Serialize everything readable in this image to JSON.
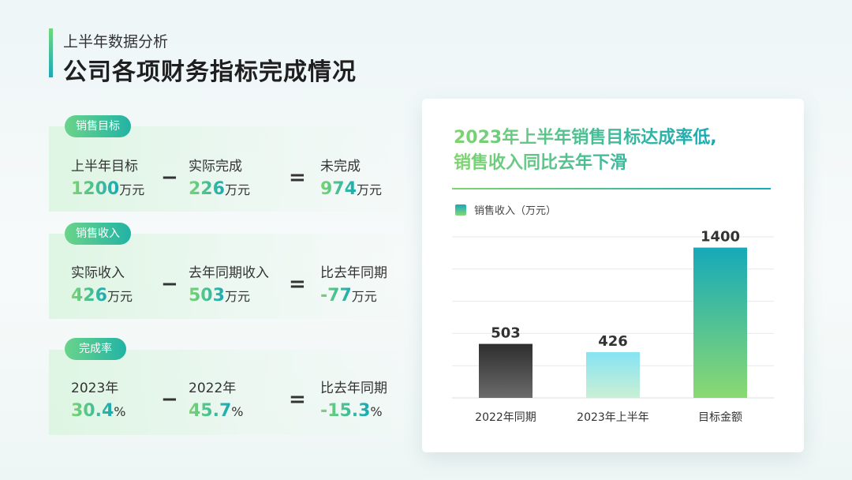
{
  "header": {
    "subtitle": "上半年数据分析",
    "title": "公司各项财务指标完成情况"
  },
  "rows": [
    {
      "tag": "销售目标",
      "cells": [
        {
          "label": "上半年目标",
          "value": "1200",
          "unit": "万元"
        },
        {
          "label": "实际完成",
          "value": "226",
          "unit": "万元"
        },
        {
          "label": "未完成",
          "value": "974",
          "unit": "万元"
        }
      ],
      "op1": "−",
      "op2": "="
    },
    {
      "tag": "销售收入",
      "cells": [
        {
          "label": "实际收入",
          "value": "426",
          "unit": "万元"
        },
        {
          "label": "去年同期收入",
          "value": "503",
          "unit": "万元"
        },
        {
          "label": "比去年同期",
          "value": "-77",
          "unit": "万元"
        }
      ],
      "op1": "−",
      "op2": "="
    },
    {
      "tag": "完成率",
      "cells": [
        {
          "label": "2023年",
          "value": "30.4",
          "unit": "%"
        },
        {
          "label": "2022年",
          "value": "45.7",
          "unit": "%"
        },
        {
          "label": "比去年同期",
          "value": "-15.3",
          "unit": "%"
        }
      ],
      "op1": "−",
      "op2": "="
    }
  ],
  "card": {
    "title_line1": "2023年上半年销售目标达成率低,",
    "title_line2": "销售收入同比去年下滑"
  },
  "chart_data": {
    "type": "bar",
    "title": "",
    "xlabel": "",
    "ylabel": "",
    "categories": [
      "2022年同期",
      "2023年上半年",
      "目标金额"
    ],
    "series": [
      {
        "name": "销售收入（万元）",
        "values": [
          503,
          426,
          1400
        ]
      }
    ],
    "data_labels": [
      "503",
      "426",
      "1400"
    ],
    "ylim": [
      0,
      1500
    ],
    "grid": true,
    "legend": "top-left",
    "colors": {
      "bar_2022": [
        "#2e2e2e",
        "#6b6b6b"
      ],
      "bar_2023": [
        "#86e3f3",
        "#c9f0d4"
      ],
      "bar_target": [
        "#16a9b9",
        "#8ad972"
      ],
      "grid": "#e6eaea",
      "label": "#333333"
    }
  }
}
